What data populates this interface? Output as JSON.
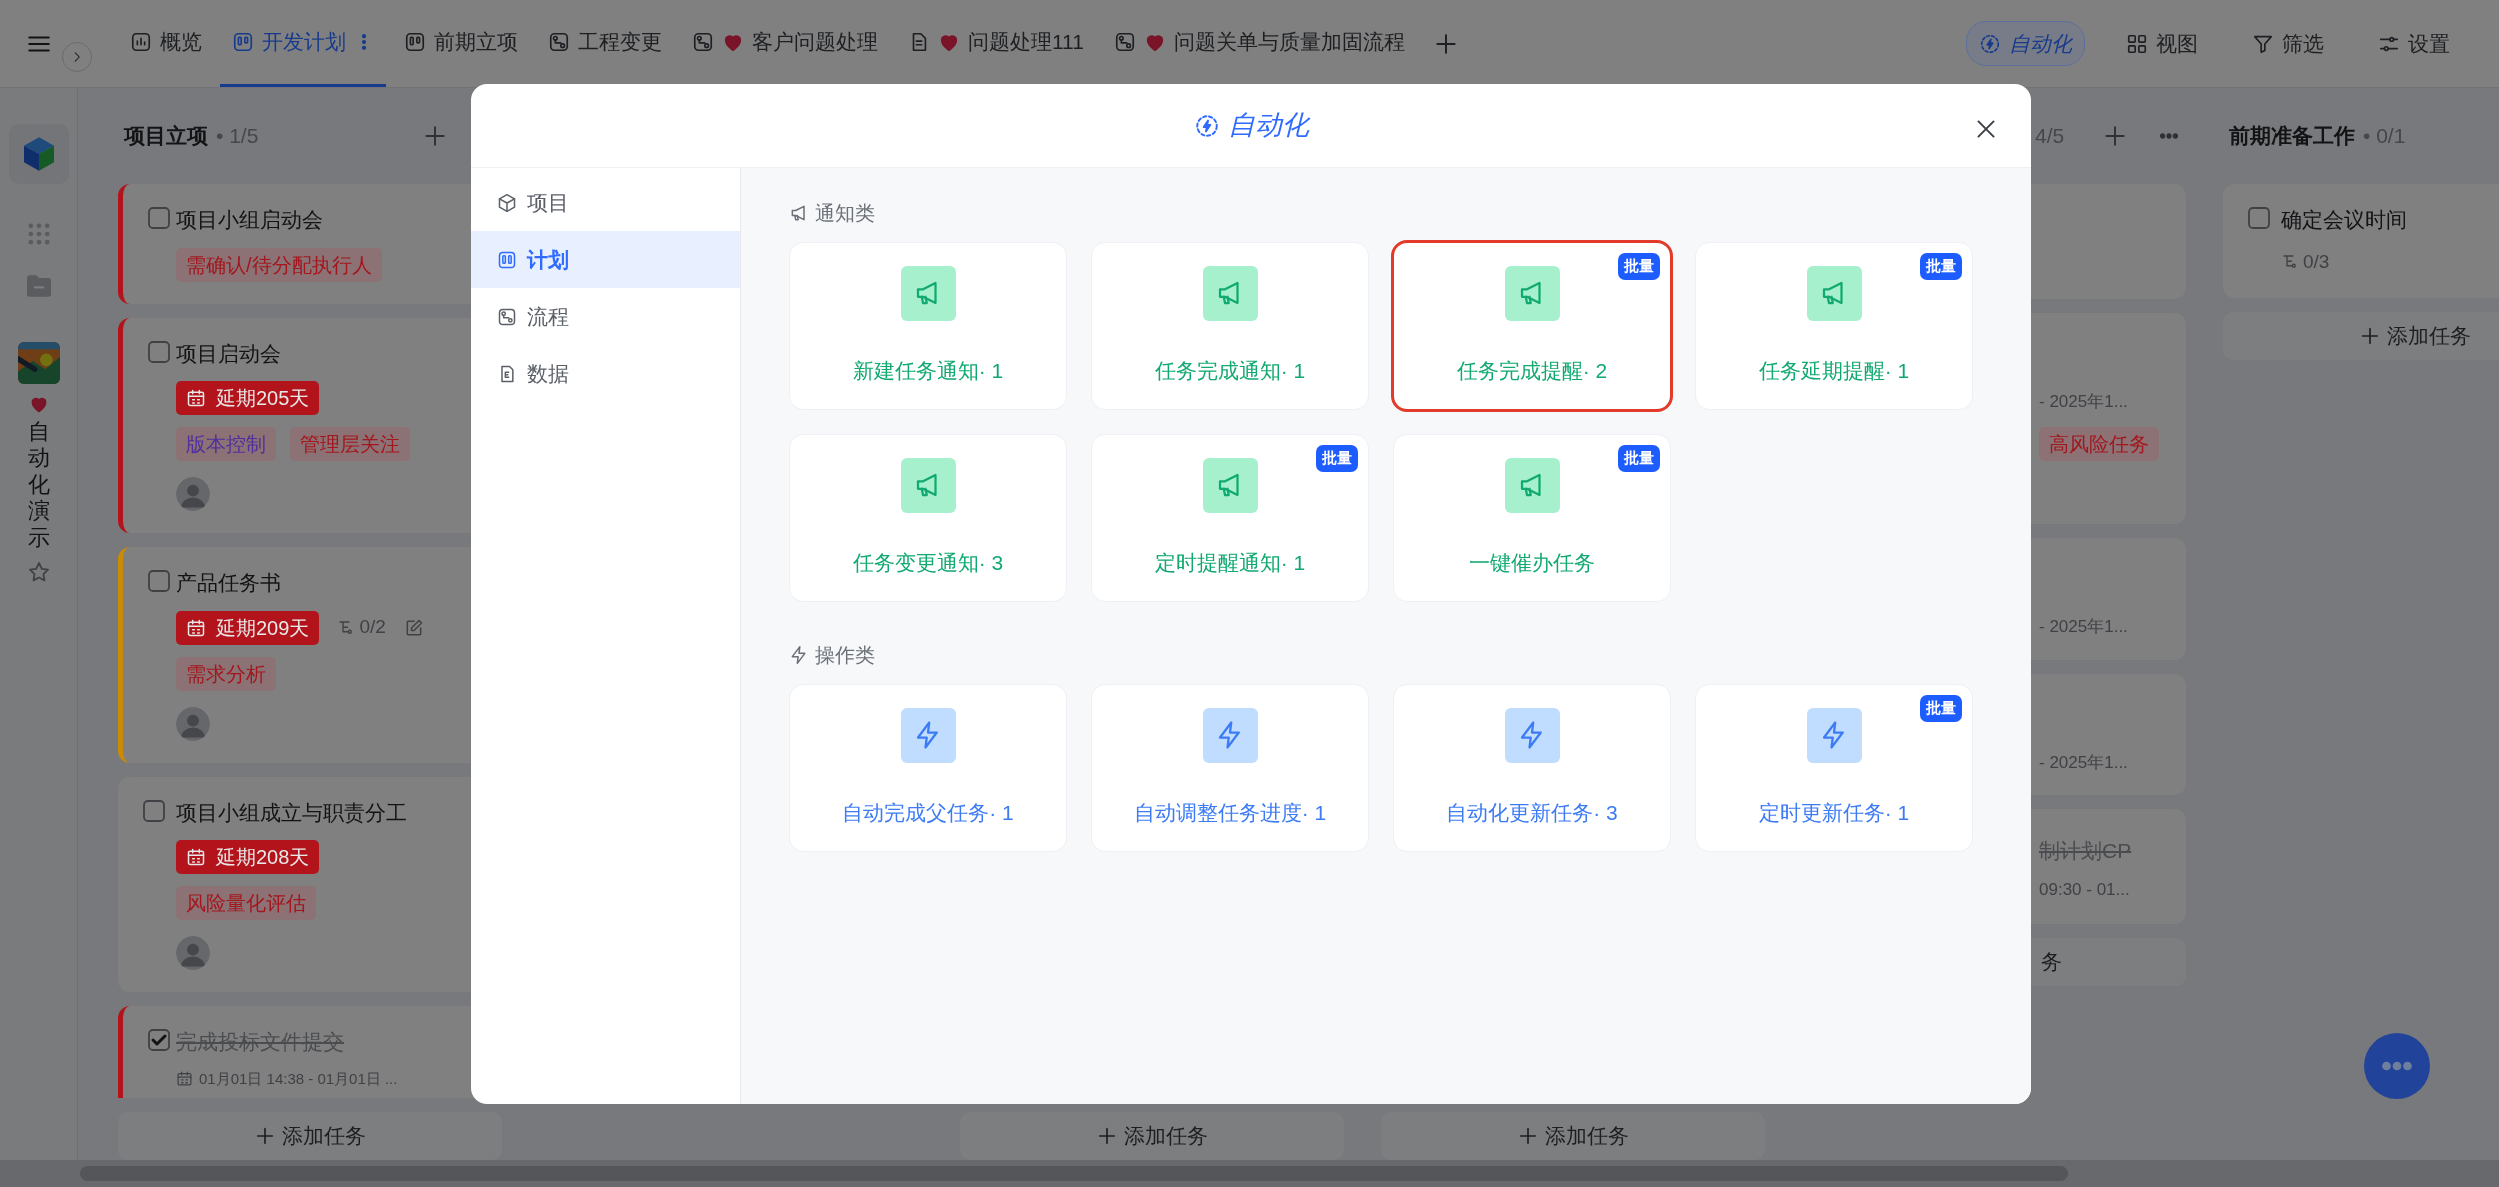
{
  "topbar": {
    "tabs": [
      {
        "label": "概览",
        "kind": "dashboard",
        "favorite": false,
        "selected": false
      },
      {
        "label": "开发计划",
        "kind": "kanban",
        "favorite": false,
        "selected": true
      },
      {
        "label": "前期立项",
        "kind": "kanban",
        "favorite": false,
        "selected": false
      },
      {
        "label": "工程变更",
        "kind": "flow",
        "favorite": false,
        "selected": false
      },
      {
        "label": "客户问题处理",
        "kind": "flow",
        "favorite": true,
        "selected": false
      },
      {
        "label": "问题处理111",
        "kind": "document",
        "favorite": true,
        "selected": false
      },
      {
        "label": "问题关单与质量加固流程",
        "kind": "flow",
        "favorite": true,
        "selected": false
      }
    ],
    "tools": [
      {
        "label": "自动化",
        "kind": "automation",
        "active": true
      },
      {
        "label": "视图",
        "kind": "view",
        "active": false
      },
      {
        "label": "筛选",
        "kind": "filter",
        "active": false
      },
      {
        "label": "设置",
        "kind": "settings",
        "active": false
      }
    ]
  },
  "rail": {
    "workspace": "自动化演示",
    "favorite": true
  },
  "board": {
    "columns": [
      {
        "title": "项目立项",
        "count": "• 1/5",
        "cards": [
          {
            "title": "项目小组启动会",
            "done": false,
            "color": "#b3141c",
            "tags": [
              {
                "label": "需确认/待分配执行人",
                "color": "#a3161e"
              }
            ]
          },
          {
            "title": "项目启动会",
            "done": false,
            "color": "#b3141c",
            "overdue": "延期205天",
            "tags": [
              {
                "label": "版本控制",
                "color": "#4f2f9e"
              },
              {
                "label": "管理层关注",
                "color": "#a3161e"
              }
            ],
            "avatar": true
          },
          {
            "title": "产品任务书",
            "done": false,
            "color": "#c98a05",
            "overdue": "延期209天",
            "subtasks": "0/2",
            "editable": true,
            "tags": [
              {
                "label": "需求分析",
                "color": "#a3161e"
              }
            ],
            "avatar": true
          },
          {
            "title": "项目小组成立与职责分工",
            "done": false,
            "overdue": "延期208天",
            "tags": [
              {
                "label": "风险量化评估",
                "color": "#a3161e"
              }
            ],
            "avatar": true
          },
          {
            "title": "完成投标文件提交",
            "done": true,
            "color": "#b3141c",
            "date": "01月01日 14:38 - 01月01日 ..."
          }
        ],
        "add_label": "添加任务"
      },
      {
        "add_label": "添加任务"
      },
      {
        "add_label": "添加任务"
      },
      {
        "count": "4/5",
        "covered": true,
        "cards": [
          {
            "covered": true
          },
          {
            "covered": true,
            "date": "- 2025年1...",
            "tags": [
              {
                "label": "高风险任务",
                "color": "#a3161e"
              }
            ]
          },
          {
            "covered": true,
            "date": "- 2025年1..."
          },
          {
            "covered": true,
            "date": "- 2025年1..."
          },
          {
            "covered": true,
            "title": "制计划CP",
            "done": true,
            "date": "09:30 - 01..."
          }
        ],
        "add_label": "务"
      },
      {
        "title": "前期准备工作",
        "count": "• 0/1",
        "cards": [
          {
            "title": "确定会议时间",
            "done": false,
            "subtasks": "0/3"
          }
        ],
        "add_label": "添加任务"
      }
    ]
  },
  "automation_dialog": {
    "title": "自动化",
    "nav": [
      {
        "label": "项目",
        "kind": "project",
        "selected": false
      },
      {
        "label": "计划",
        "kind": "plan",
        "selected": true
      },
      {
        "label": "流程",
        "kind": "flow",
        "selected": false
      },
      {
        "label": "数据",
        "kind": "data",
        "selected": false
      }
    ],
    "sections": [
      {
        "title": "通知类",
        "kind": "notify",
        "cards": [
          {
            "label": "新建任务通知· 1",
            "highlighted": false
          },
          {
            "label": "任务完成通知· 1",
            "highlighted": false
          },
          {
            "label": "任务完成提醒· 2",
            "badge": "批量",
            "highlighted": true
          },
          {
            "label": "任务延期提醒· 1",
            "badge": "批量",
            "highlighted": false
          },
          {
            "label": "任务变更通知· 3",
            "highlighted": false
          },
          {
            "label": "定时提醒通知· 1",
            "badge": "批量",
            "highlighted": false
          },
          {
            "label": "一键催办任务",
            "badge": "批量",
            "highlighted": false
          }
        ]
      },
      {
        "title": "操作类",
        "kind": "action",
        "cards": [
          {
            "label": "自动完成父任务· 1",
            "highlighted": false
          },
          {
            "label": "自动调整任务进度· 1",
            "highlighted": false
          },
          {
            "label": "自动化更新任务· 3",
            "highlighted": false
          },
          {
            "label": "定时更新任务· 1",
            "badge": "批量",
            "highlighted": false
          }
        ]
      }
    ]
  }
}
